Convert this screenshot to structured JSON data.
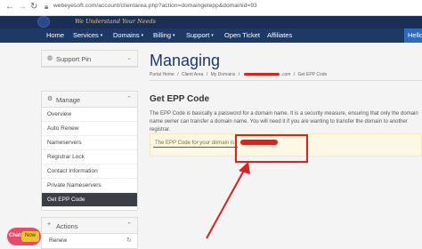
{
  "browser": {
    "back_icon": "arrow-left-icon",
    "forward_icon": "arrow-right-icon",
    "reload_icon": "reload-icon",
    "lock_icon": "lock-icon",
    "url": "webeyesoft.com/account/clientarea.php?action=domaingetepp&domainid=93"
  },
  "header": {
    "tagline": "We Understand Your Needs"
  },
  "nav": {
    "items": [
      {
        "label": "Home"
      },
      {
        "label": "Services",
        "dropdown": true
      },
      {
        "label": "Domains",
        "dropdown": true
      },
      {
        "label": "Billing",
        "dropdown": true
      },
      {
        "label": "Support",
        "dropdown": true
      },
      {
        "label": "Open Ticket"
      },
      {
        "label": "Affiliates"
      }
    ],
    "caret": "▾",
    "hello": "Hello"
  },
  "sidebar": {
    "support_pin": {
      "title": "Support Pin",
      "icon": "globe-icon",
      "chevron": "⌄"
    },
    "manage": {
      "title": "Manage",
      "icon": "gear-icon",
      "chevron": "⌃",
      "items": [
        {
          "label": "Overview"
        },
        {
          "label": "Auto Renew"
        },
        {
          "label": "Nameservers"
        },
        {
          "label": "Registrar Lock"
        },
        {
          "label": "Contact Information"
        },
        {
          "label": "Private Nameservers"
        },
        {
          "label": "Get EPP Code",
          "active": true
        }
      ]
    },
    "actions": {
      "title": "Actions",
      "icon": "plus-icon",
      "chevron": "⌃",
      "items": [
        {
          "label": "Renew",
          "icon": "refresh-icon"
        }
      ]
    }
  },
  "main": {
    "page_title": "Managing",
    "breadcrumb": {
      "portal_home": "Portal Home",
      "sep": "/",
      "client_area": "Client Area",
      "my_domains": "My Domains",
      "tld": ".com",
      "current": "Get EPP Code"
    },
    "section_title": "Get EPP Code",
    "description": "The EPP Code is basically a password for a domain name. It is a security measure, ensuring that only the domain name owner can transfer a domain name. You will need it if you are wanting to transfer the domain to another registrar.",
    "alert": {
      "text": "The EPP Code for your domain is"
    }
  },
  "annotations": {
    "color": "#e0201b"
  },
  "chat": {
    "label": "Chat",
    "badge": "Now"
  }
}
